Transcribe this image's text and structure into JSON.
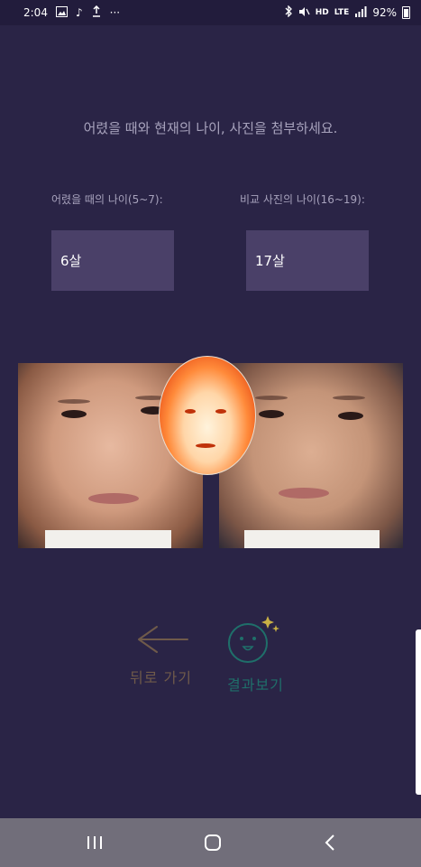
{
  "status_bar": {
    "time": "2:04",
    "more": "···",
    "network_hd": "HD",
    "network_lte": "LTE",
    "battery_percent": "92%",
    "left_icons": [
      "image-icon",
      "music-note-icon",
      "upload-icon"
    ],
    "right_icons": [
      "bluetooth-icon",
      "mute-icon",
      "signal-icon",
      "battery-icon"
    ]
  },
  "instruction": "어렸을 때와 현재의 나이, 사진을 첨부하세요.",
  "child_age": {
    "label": "어렸을 때의 나이(5~7):",
    "value": "6살"
  },
  "compare_age": {
    "label": "비교 사진의 나이(16~19):",
    "value": "17살"
  },
  "actions": {
    "back_label": "뒤로 가기",
    "result_label": "결과보기",
    "back_color": "#6f5a4a",
    "result_color": "#1f6f6a"
  },
  "colors": {
    "background": "#2a2446",
    "input_bg": "#4a4068",
    "label_text": "#a7a2bc",
    "nav_bar": "#716e7a"
  }
}
